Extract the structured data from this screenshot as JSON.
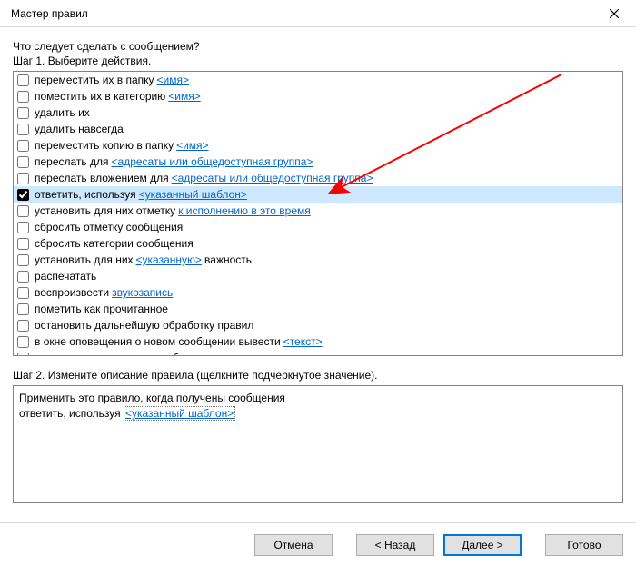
{
  "window": {
    "title": "Мастер правил"
  },
  "intro": "Что следует сделать с сообщением?",
  "step1_heading": "Шаг 1. Выберите действия.",
  "actions": [
    {
      "id": "move-to-folder",
      "checked": false,
      "label_pre": "переместить их в папку ",
      "link": "<имя>",
      "label_post": ""
    },
    {
      "id": "to-category",
      "checked": false,
      "label_pre": "поместить их в категорию ",
      "link": "<имя>",
      "label_post": ""
    },
    {
      "id": "delete",
      "checked": false,
      "label_pre": "удалить их",
      "link": "",
      "label_post": ""
    },
    {
      "id": "delete-permanent",
      "checked": false,
      "label_pre": "удалить навсегда",
      "link": "",
      "label_post": ""
    },
    {
      "id": "move-copy",
      "checked": false,
      "label_pre": "переместить копию в папку ",
      "link": "<имя>",
      "label_post": ""
    },
    {
      "id": "forward-to",
      "checked": false,
      "label_pre": "переслать для ",
      "link": "<адресаты или общедоступная группа>",
      "label_post": ""
    },
    {
      "id": "forward-attach",
      "checked": false,
      "label_pre": "переслать вложением для ",
      "link": "<адресаты или общедоступная группа>",
      "label_post": ""
    },
    {
      "id": "reply-template",
      "checked": true,
      "label_pre": "ответить, используя ",
      "link": "<указанный шаблон>",
      "label_post": "",
      "selected": true
    },
    {
      "id": "flag-followup",
      "checked": false,
      "label_pre": "установить для них отметку ",
      "link": "к исполнению в это время",
      "label_post": ""
    },
    {
      "id": "clear-flag",
      "checked": false,
      "label_pre": "сбросить отметку сообщения",
      "link": "",
      "label_post": ""
    },
    {
      "id": "clear-categories",
      "checked": false,
      "label_pre": "сбросить категории сообщения",
      "link": "",
      "label_post": ""
    },
    {
      "id": "set-importance",
      "checked": false,
      "label_pre": "установить для них ",
      "link": "<указанную>",
      "label_post": " важность"
    },
    {
      "id": "print",
      "checked": false,
      "label_pre": "распечатать",
      "link": "",
      "label_post": ""
    },
    {
      "id": "play-sound",
      "checked": false,
      "label_pre": "воспроизвести ",
      "link": "звукозапись",
      "label_post": ""
    },
    {
      "id": "mark-read",
      "checked": false,
      "label_pre": "пометить как прочитанное",
      "link": "",
      "label_post": ""
    },
    {
      "id": "stop-processing",
      "checked": false,
      "label_pre": "остановить дальнейшую обработку правил",
      "link": "",
      "label_post": ""
    },
    {
      "id": "desktop-alert-text",
      "checked": false,
      "label_pre": "в окне оповещения о новом сообщении вывести ",
      "link": "<текст>",
      "label_post": ""
    },
    {
      "id": "desktop-alert",
      "checked": false,
      "label_pre": "вывести оповещения на рабочем столе",
      "link": "",
      "label_post": ""
    }
  ],
  "step2_heading": "Шаг 2. Измените описание правила (щелкните подчеркнутое значение).",
  "description": {
    "line1": "Применить это правило, когда получены сообщения",
    "line2_pre": "ответить, используя ",
    "line2_link": "<указанный шаблон>"
  },
  "buttons": {
    "cancel": "Отмена",
    "back": "< Назад",
    "next": "Далее >",
    "finish": "Готово"
  }
}
